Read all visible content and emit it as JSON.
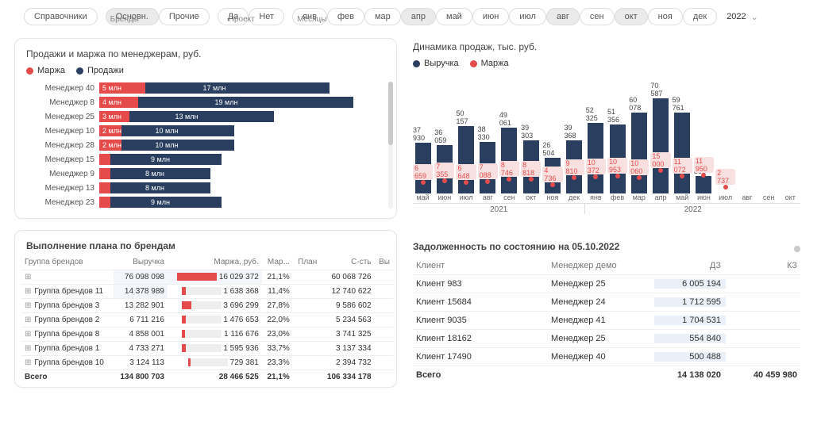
{
  "filters": {
    "ref": "Справочники",
    "brands_label": "Бренды",
    "brands": [
      {
        "l": "Основн.",
        "sel": true
      },
      {
        "l": "Прочие",
        "sel": false
      }
    ],
    "project_label": "Проект",
    "project": [
      {
        "l": "Да",
        "sel": false
      },
      {
        "l": "Нет",
        "sel": false
      }
    ],
    "months_label": "Месяцы",
    "months": [
      {
        "l": "янв",
        "sel": false
      },
      {
        "l": "фев",
        "sel": false
      },
      {
        "l": "мар",
        "sel": false
      },
      {
        "l": "апр",
        "sel": true
      },
      {
        "l": "май",
        "sel": false
      },
      {
        "l": "июн",
        "sel": false
      },
      {
        "l": "июл",
        "sel": false
      },
      {
        "l": "авг",
        "sel": true
      },
      {
        "l": "сен",
        "sel": false
      },
      {
        "l": "окт",
        "sel": true
      },
      {
        "l": "ноя",
        "sel": false
      },
      {
        "l": "дек",
        "sel": false
      }
    ],
    "year": "2022"
  },
  "mgr_chart": {
    "title": "Продажи и маржа по менеджерам, руб.",
    "legend": {
      "m": "Маржа",
      "s": "Продажи"
    },
    "rows": [
      {
        "name": "Менеджер 40",
        "ml": "5 млн",
        "mw": 58,
        "sl": "17 млн",
        "sw": 290
      },
      {
        "name": "Менеджер 8",
        "ml": "4 млн",
        "mw": 49,
        "sl": "19 млн",
        "sw": 320
      },
      {
        "name": "Менеджер 25",
        "ml": "3 млн",
        "mw": 38,
        "sl": "13 млн",
        "sw": 220
      },
      {
        "name": "Менеджер 10",
        "ml": "2 млн",
        "mw": 28,
        "sl": "10 млн",
        "sw": 170
      },
      {
        "name": "Менеджер 28",
        "ml": "2 млн",
        "mw": 28,
        "sl": "10 млн",
        "sw": 170
      },
      {
        "name": "Менеджер 15",
        "ml": "",
        "mw": 14,
        "sl": "9 млн",
        "sw": 154
      },
      {
        "name": "Менеджер 9",
        "ml": "",
        "mw": 14,
        "sl": "8 млн",
        "sw": 140
      },
      {
        "name": "Менеджер 13",
        "ml": "",
        "mw": 14,
        "sl": "8 млн",
        "sw": 140
      },
      {
        "name": "Менеджер 23",
        "ml": "",
        "mw": 14,
        "sl": "9 млн",
        "sw": 154
      }
    ]
  },
  "plan": {
    "title": "Выполнение плана по брендам",
    "headers": [
      "Группа брендов",
      "Выручка",
      "Маржа, руб.",
      "Мар...",
      "План",
      "С-сть",
      "Вы"
    ],
    "rows": [
      {
        "g": "",
        "rev": "76 098 098",
        "mar": "16 029 372",
        "mp": "21,1%",
        "pl": "",
        "cost": "60 068 726",
        "mf": 100,
        "sh": true,
        "marsh": true
      },
      {
        "g": "Группа брендов 11",
        "rev": "14 378 989",
        "mar": "1 638 368",
        "mp": "11,4%",
        "pl": "",
        "cost": "12 740 622",
        "mf": 11,
        "sh": true
      },
      {
        "g": "Группа брендов 3",
        "rev": "13 282 901",
        "mar": "3 696 299",
        "mp": "27,8%",
        "pl": "",
        "cost": "9 586 602",
        "mf": 24
      },
      {
        "g": "Группа брендов 2",
        "rev": "6 711 216",
        "mar": "1 476 653",
        "mp": "22,0%",
        "pl": "",
        "cost": "5 234 563",
        "mf": 10
      },
      {
        "g": "Группа брендов 8",
        "rev": "4 858 001",
        "mar": "1 116 676",
        "mp": "23,0%",
        "pl": "",
        "cost": "3 741 325",
        "mf": 8
      },
      {
        "g": "Группа брендов 1",
        "rev": "4 733 271",
        "mar": "1 595 936",
        "mp": "33,7%",
        "pl": "",
        "cost": "3 137 334",
        "mf": 11
      },
      {
        "g": "Группа брендов 10",
        "rev": "3 124 113",
        "mar": "729 381",
        "mp": "23,3%",
        "pl": "",
        "cost": "2 394 732",
        "mf": 6
      }
    ],
    "total": {
      "lbl": "Всего",
      "rev": "134 800 703",
      "mar": "28 466 525",
      "mp": "21,1%",
      "cost": "106 334 178"
    }
  },
  "dyn": {
    "title": "Динамика продаж, тыс. руб.",
    "legend": {
      "r": "Выручка",
      "m": "Маржа"
    },
    "months": [
      "май",
      "июн",
      "июл",
      "авг",
      "сен",
      "окт",
      "ноя",
      "дек",
      "янв",
      "фев",
      "мар",
      "апр",
      "май",
      "июн",
      "июл",
      "авг",
      "сен",
      "окт"
    ],
    "years": [
      "2021",
      "2022"
    ],
    "year_split": 8,
    "rev": [
      37930,
      36059,
      50157,
      38330,
      49061,
      39303,
      26504,
      39368,
      52325,
      51356,
      60078,
      70587,
      59761,
      12860,
      0,
      0,
      0,
      0
    ],
    "mar": [
      6659,
      7355,
      6648,
      7088,
      8746,
      8818,
      4736,
      9810,
      10372,
      10953,
      10060,
      15000,
      11072,
      11950,
      2737,
      0,
      0,
      0
    ]
  },
  "chart_data": [
    {
      "type": "bar",
      "title": "Продажи и маржа по менеджерам, руб.",
      "orientation": "horizontal",
      "categories": [
        "Менеджер 40",
        "Менеджер 8",
        "Менеджер 25",
        "Менеджер 10",
        "Менеджер 28",
        "Менеджер 15",
        "Менеджер 9",
        "Менеджер 13",
        "Менеджер 23"
      ],
      "series": [
        {
          "name": "Маржа",
          "values": [
            5000000,
            4000000,
            3000000,
            2000000,
            2000000,
            1000000,
            1000000,
            1000000,
            1000000
          ]
        },
        {
          "name": "Продажи",
          "values": [
            17000000,
            19000000,
            13000000,
            10000000,
            10000000,
            9000000,
            8000000,
            8000000,
            9000000
          ]
        }
      ]
    },
    {
      "type": "bar",
      "title": "Динамика продаж, тыс. руб.",
      "categories": [
        "2021-май",
        "2021-июн",
        "2021-июл",
        "2021-авг",
        "2021-сен",
        "2021-окт",
        "2021-ноя",
        "2021-дек",
        "2022-янв",
        "2022-фев",
        "2022-мар",
        "2022-апр",
        "2022-май",
        "2022-июн",
        "2022-июл",
        "2022-авг",
        "2022-сен",
        "2022-окт"
      ],
      "series": [
        {
          "name": "Выручка",
          "values": [
            37930,
            36059,
            50157,
            38330,
            49061,
            39303,
            26504,
            39368,
            52325,
            51356,
            60078,
            70587,
            59761,
            12860,
            null,
            null,
            null,
            null
          ]
        },
        {
          "name": "Маржа",
          "values": [
            6659,
            7355,
            6648,
            7088,
            8746,
            8818,
            4736,
            9810,
            10372,
            10953,
            10060,
            15000,
            11072,
            11950,
            2737,
            null,
            null,
            null
          ]
        }
      ],
      "ylabel": "тыс. руб."
    }
  ],
  "debt": {
    "title": "Задолженность по состоянию на 05.10.2022",
    "headers": {
      "c1": "Клиент",
      "c2": "Менеджер демо",
      "c3": "ДЗ",
      "c4": "КЗ"
    },
    "rows": [
      {
        "c": "Клиент 983",
        "m": "Менеджер 25",
        "d": "6 005 194",
        "k": ""
      },
      {
        "c": "Клиент 15684",
        "m": "Менеджер 24",
        "d": "1 712 595",
        "k": ""
      },
      {
        "c": "Клиент 9035",
        "m": "Менеджер 41",
        "d": "1 704 531",
        "k": ""
      },
      {
        "c": "Клиент 18162",
        "m": "Менеджер 25",
        "d": "554 840",
        "k": ""
      },
      {
        "c": "Клиент 17490",
        "m": "Менеджер 40",
        "d": "500 488",
        "k": ""
      }
    ],
    "total": {
      "lbl": "Всего",
      "d": "14 138 020",
      "k": "40 459 980"
    }
  }
}
